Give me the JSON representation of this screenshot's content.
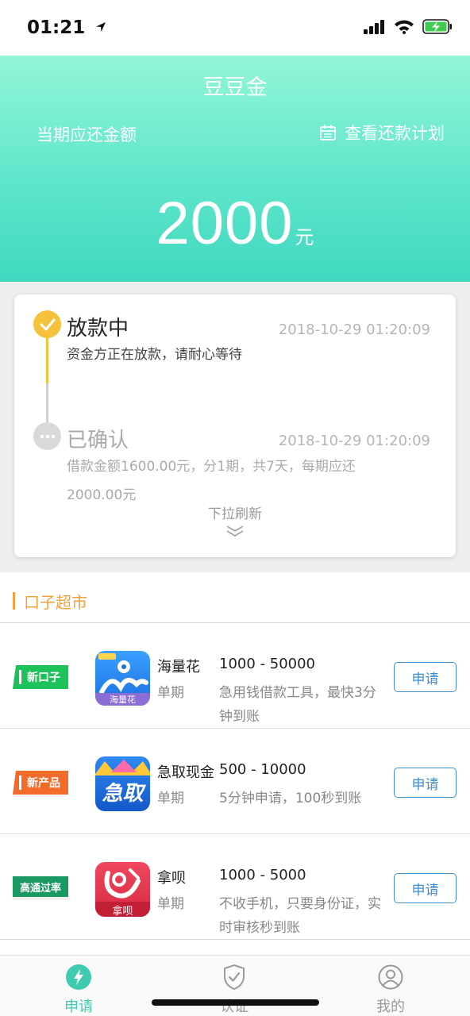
{
  "status_bar": {
    "time": "01:21"
  },
  "header": {
    "title": "豆豆金",
    "due_label": "当期应还金额",
    "plan_link": "查看还款计划",
    "amount": "2000",
    "amount_unit": "元"
  },
  "status_card": {
    "steps": [
      {
        "title": "放款中",
        "time": "2018-10-29 01:20:09",
        "desc": "资金方正在放款，请耐心等待"
      },
      {
        "title": "已确认",
        "time": "2018-10-29 01:20:09",
        "desc_line1": "借款金额1600.00元，分1期，共7天，每期应还",
        "desc_line2": "2000.00元"
      }
    ],
    "pull_hint": "下拉刷新"
  },
  "market": {
    "title": "口子超市",
    "items": [
      {
        "badge": "新口子",
        "badge_color": "#1ec25a",
        "name": "海量花",
        "icon_text": "海量花",
        "term": "单期",
        "range": "1000 - 50000",
        "desc": "急用钱借款工具，最快3分钟到账",
        "apply": "申请"
      },
      {
        "badge": "新产品",
        "badge_color": "#f26b2b",
        "name": "急取现金",
        "icon_text": "急取",
        "term": "单期",
        "range": "500 - 10000",
        "desc": "5分钟申请，100秒到账",
        "apply": "申请"
      },
      {
        "badge": "高通过率",
        "badge_color": "#1a9a62",
        "name": "拿呗",
        "icon_text": "拿呗",
        "term": "单期",
        "range": "1000 - 5000",
        "desc": "不收手机，只要身份证，实时审核秒到账",
        "apply": "申请"
      }
    ]
  },
  "tabbar": {
    "tabs": [
      {
        "label": "申请",
        "icon": "bolt-icon",
        "active": true
      },
      {
        "label": "认证",
        "icon": "shield-check-icon",
        "active": false
      },
      {
        "label": "我的",
        "icon": "user-icon",
        "active": false
      }
    ]
  },
  "colors": {
    "accent": "#3ecbb0",
    "warning": "#f7c23b",
    "market_title": "#f2a13b",
    "button": "#3b8fd6"
  }
}
